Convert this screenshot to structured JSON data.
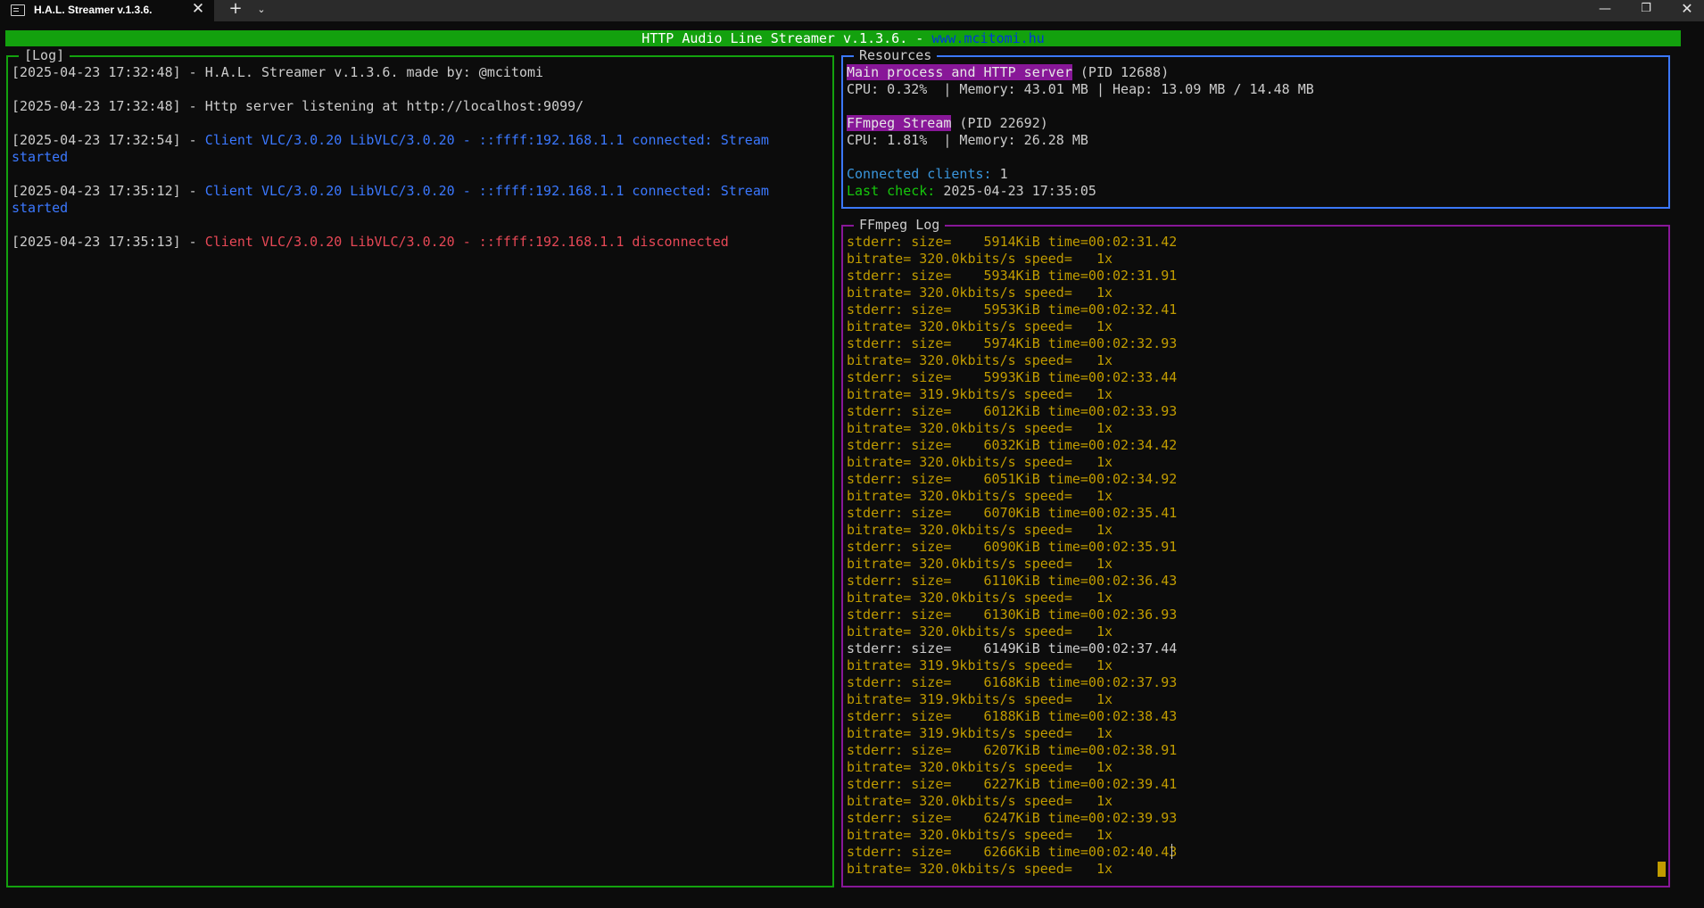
{
  "window": {
    "tab_title": "H.A.L. Streamer v.1.3.6.",
    "tab_close": "✕",
    "new_tab": "+",
    "tab_dropdown": "⌄",
    "minimize": "—",
    "maximize": "❐",
    "close": "✕",
    "icon": "terminal-icon"
  },
  "header": {
    "title": "HTTP Audio Line Streamer v.1.3.6. - ",
    "url": "www.mcitomi.hu"
  },
  "log_panel": {
    "label": "[Log]",
    "entries": [
      {
        "prefix": "[2025-04-23 17:32:48] - ",
        "text": "H.A.L. Streamer v.1.3.6. made by: @mcitomi",
        "color": "white"
      },
      {
        "prefix": "[2025-04-23 17:32:48] - ",
        "text": "Http server listening at http://localhost:9099/",
        "color": "white"
      },
      {
        "prefix": "[2025-04-23 17:32:54] - ",
        "text": "Client VLC/3.0.20 LibVLC/3.0.20 - ::ffff:192.168.1.1 connected: Stream started",
        "color": "blue"
      },
      {
        "prefix": "[2025-04-23 17:35:12] - ",
        "text": "Client VLC/3.0.20 LibVLC/3.0.20 - ::ffff:192.168.1.1 connected: Stream started",
        "color": "blue"
      },
      {
        "prefix": "[2025-04-23 17:35:13] - ",
        "text": "Client VLC/3.0.20 LibVLC/3.0.20 - ::ffff:192.168.1.1 disconnected",
        "color": "red"
      }
    ]
  },
  "resources": {
    "label": "Resources",
    "main_process": {
      "name": "Main process and HTTP server",
      "pid": " (PID 12688)",
      "stats": "CPU: 0.32%  | Memory: 43.01 MB | Heap: 13.09 MB / 14.48 MB"
    },
    "ffmpeg": {
      "name": "FFmpeg Stream",
      "pid": " (PID 22692)",
      "stats": "CPU: 1.81%  | Memory: 26.28 MB"
    },
    "connected_label": "Connected clients:",
    "connected_value": " 1",
    "last_check_label": "Last check:",
    "last_check_value": " 2025-04-23 17:35:05"
  },
  "ffmpeg_log": {
    "label": "FFmpeg Log",
    "lines": [
      "stderr: size=    5914KiB time=00:02:31.42",
      "bitrate= 320.0kbits/s speed=   1x",
      "stderr: size=    5934KiB time=00:02:31.91",
      "bitrate= 320.0kbits/s speed=   1x",
      "stderr: size=    5953KiB time=00:02:32.41",
      "bitrate= 320.0kbits/s speed=   1x",
      "stderr: size=    5974KiB time=00:02:32.93",
      "bitrate= 320.0kbits/s speed=   1x",
      "stderr: size=    5993KiB time=00:02:33.44",
      "bitrate= 319.9kbits/s speed=   1x",
      "stderr: size=    6012KiB time=00:02:33.93",
      "bitrate= 320.0kbits/s speed=   1x",
      "stderr: size=    6032KiB time=00:02:34.42",
      "bitrate= 320.0kbits/s speed=   1x",
      "stderr: size=    6051KiB time=00:02:34.92",
      "bitrate= 320.0kbits/s speed=   1x",
      "stderr: size=    6070KiB time=00:02:35.41",
      "bitrate= 320.0kbits/s speed=   1x",
      "stderr: size=    6090KiB time=00:02:35.91",
      "bitrate= 320.0kbits/s speed=   1x",
      "stderr: size=    6110KiB time=00:02:36.43",
      "bitrate= 320.0kbits/s speed=   1x",
      "stderr: size=    6130KiB time=00:02:36.93",
      "bitrate= 320.0kbits/s speed=   1x",
      "stderr: size=    6149KiB time=00:02:37.44",
      "bitrate= 319.9kbits/s speed=   1x",
      "stderr: size=    6168KiB time=00:02:37.93",
      "bitrate= 319.9kbits/s speed=   1x",
      "stderr: size=    6188KiB time=00:02:38.43",
      "bitrate= 319.9kbits/s speed=   1x",
      "stderr: size=    6207KiB time=00:02:38.91",
      "bitrate= 320.0kbits/s speed=   1x",
      "stderr: size=    6227KiB time=00:02:39.41",
      "bitrate= 320.0kbits/s speed=   1x",
      "stderr: size=    6247KiB time=00:02:39.93",
      "bitrate= 320.0kbits/s speed=   1x",
      "stderr: size=    6266KiB time=00:02:40.43",
      "bitrate= 320.0kbits/s speed=   1x"
    ]
  },
  "colors": {
    "background": "#0c0c0c",
    "header_green": "#13a10e",
    "log_border": "#13a10e",
    "resources_border": "#3b78ff",
    "ffmpeg_border": "#881798",
    "highlight_purple": "#881798",
    "ffmpeg_text": "#c19c00",
    "client_blue": "#3b78ff",
    "disconnect_red": "#e74856"
  }
}
